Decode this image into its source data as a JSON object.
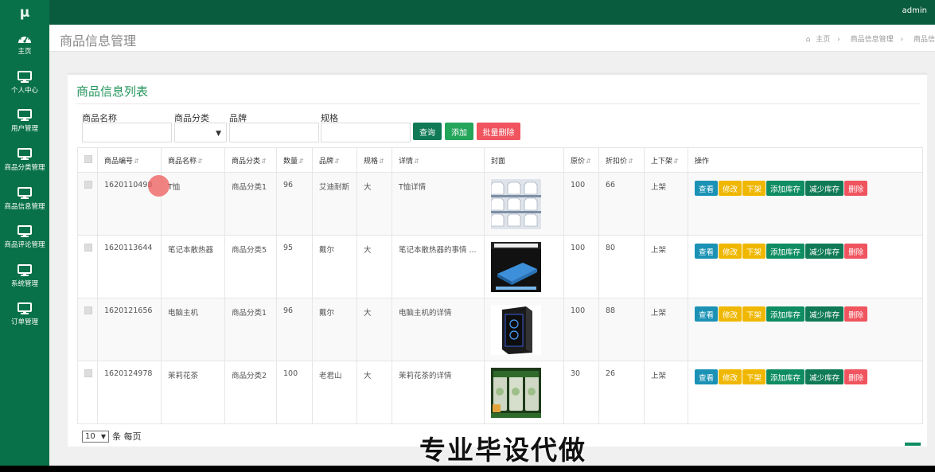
{
  "topbar": {
    "logo": "μ",
    "user": "admin"
  },
  "sidebar": {
    "items": [
      {
        "label": "主页",
        "icon": "dashboard-icon"
      },
      {
        "label": "个人中心",
        "icon": "monitor-icon"
      },
      {
        "label": "用户管理",
        "icon": "monitor-icon"
      },
      {
        "label": "商品分类管理",
        "icon": "monitor-icon"
      },
      {
        "label": "商品信息管理",
        "icon": "monitor-icon"
      },
      {
        "label": "商品评论管理",
        "icon": "monitor-icon"
      },
      {
        "label": "系统管理",
        "icon": "monitor-icon"
      },
      {
        "label": "订单管理",
        "icon": "monitor-icon"
      }
    ]
  },
  "header": {
    "title": "商品信息管理",
    "breadcrumbs": [
      "主页",
      "商品信息管理",
      "商品信"
    ]
  },
  "panel": {
    "title": "商品信息列表"
  },
  "filters": {
    "name_label": "商品名称",
    "category_label": "商品分类",
    "brand_label": "品牌",
    "spec_label": "规格"
  },
  "buttons": {
    "search": "查询",
    "add": "添加",
    "batch_delete": "批量删除"
  },
  "table": {
    "headers": [
      "商品编号",
      "商品名称",
      "商品分类",
      "数量",
      "品牌",
      "规格",
      "详情",
      "封面",
      "原价",
      "折扣价",
      "上下架",
      "操作"
    ],
    "actions": [
      "查看",
      "修改",
      "下架",
      "添加库存",
      "减少库存",
      "删除"
    ],
    "rows": [
      {
        "id": "1620110498",
        "name": "T恤",
        "category": "商品分类1",
        "qty": "96",
        "brand": "艾迪耐斯",
        "spec": "大",
        "detail": "T恤详情",
        "price": "100",
        "discount": "66",
        "status": "上架"
      },
      {
        "id": "1620113644",
        "name": "笔记本散热器",
        "category": "商品分类5",
        "qty": "95",
        "brand": "戴尔",
        "spec": "大",
        "detail": "笔记本散热器的事情 ...",
        "price": "100",
        "discount": "80",
        "status": "上架"
      },
      {
        "id": "1620121656",
        "name": "电脑主机",
        "category": "商品分类1",
        "qty": "96",
        "brand": "戴尔",
        "spec": "大",
        "detail": "电脑主机的详情",
        "price": "100",
        "discount": "88",
        "status": "上架"
      },
      {
        "id": "1620124978",
        "name": "茉莉花茶",
        "category": "商品分类2",
        "qty": "100",
        "brand": "老君山",
        "spec": "大",
        "detail": "茉莉花茶的详情",
        "price": "30",
        "discount": "26",
        "status": "上架"
      }
    ]
  },
  "pager": {
    "size": "10",
    "suffix": "条 每页"
  },
  "overlay": {
    "caption": "专业毕设代做"
  },
  "colors": {
    "brand": "#087149",
    "topbar": "#0a5c3e",
    "accent": "#23955b",
    "info": "#1b92b5",
    "warning": "#f0b700",
    "danger": "#f0545e"
  }
}
